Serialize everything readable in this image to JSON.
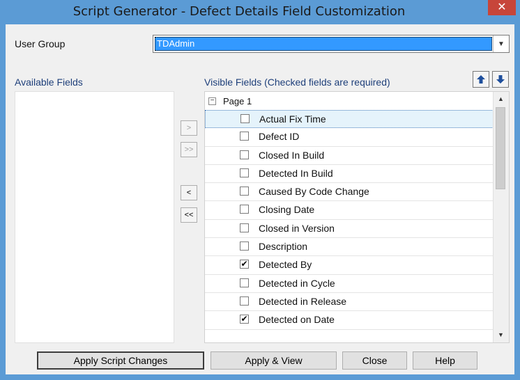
{
  "window": {
    "title": "Script Generator - Defect Details Field Customization",
    "close_label": "✕"
  },
  "user_group": {
    "label": "User Group",
    "selected": "TDAdmin"
  },
  "available_fields": {
    "label": "Available Fields",
    "items": []
  },
  "visible_fields": {
    "label": "Visible Fields (Checked fields are required)",
    "page_label": "Page 1",
    "expander": "−",
    "items": [
      {
        "label": "Actual Fix Time",
        "checked": false,
        "selected": true
      },
      {
        "label": "Defect ID",
        "checked": false,
        "selected": false
      },
      {
        "label": "Closed In Build",
        "checked": false,
        "selected": false
      },
      {
        "label": "Detected In Build",
        "checked": false,
        "selected": false
      },
      {
        "label": "Caused By Code Change",
        "checked": false,
        "selected": false
      },
      {
        "label": "Closing Date",
        "checked": false,
        "selected": false
      },
      {
        "label": "Closed in Version",
        "checked": false,
        "selected": false
      },
      {
        "label": "Description",
        "checked": false,
        "selected": false
      },
      {
        "label": "Detected By",
        "checked": true,
        "selected": false
      },
      {
        "label": "Detected in Cycle",
        "checked": false,
        "selected": false
      },
      {
        "label": "Detected in Release",
        "checked": false,
        "selected": false
      },
      {
        "label": "Detected on Date",
        "checked": true,
        "selected": false
      }
    ]
  },
  "transfer_buttons": {
    "add": ">",
    "add_all": ">>",
    "remove": "<",
    "remove_all": "<<"
  },
  "buttons": {
    "apply_script": "Apply Script Changes",
    "apply_view": "Apply & View",
    "close": "Close",
    "help": "Help"
  },
  "colors": {
    "titlebar": "#5b9bd5",
    "close": "#c7453a",
    "selection": "#3399ff",
    "move_arrow": "#1f4f9c"
  }
}
